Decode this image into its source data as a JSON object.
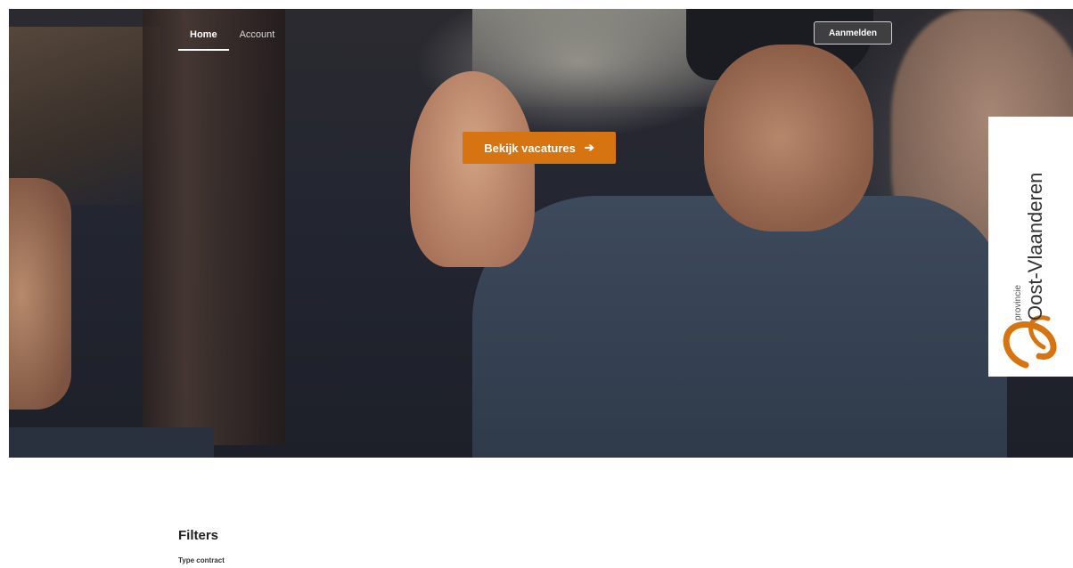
{
  "nav": {
    "items": [
      {
        "label": "Home",
        "active": true
      },
      {
        "label": "Account",
        "active": false
      }
    ]
  },
  "header": {
    "login_label": "Aanmelden"
  },
  "hero": {
    "cta_label": "Bekijk vacatures",
    "cta_icon": "arrow-right-icon"
  },
  "logo": {
    "prefix": "provincie",
    "name": "Oost-Vlaanderen",
    "brand_color": "#d67412"
  },
  "filters": {
    "title": "Filters",
    "type_contract_label": "Type contract"
  },
  "colors": {
    "accent": "#d67412",
    "button_dark": "#3f3f42"
  }
}
